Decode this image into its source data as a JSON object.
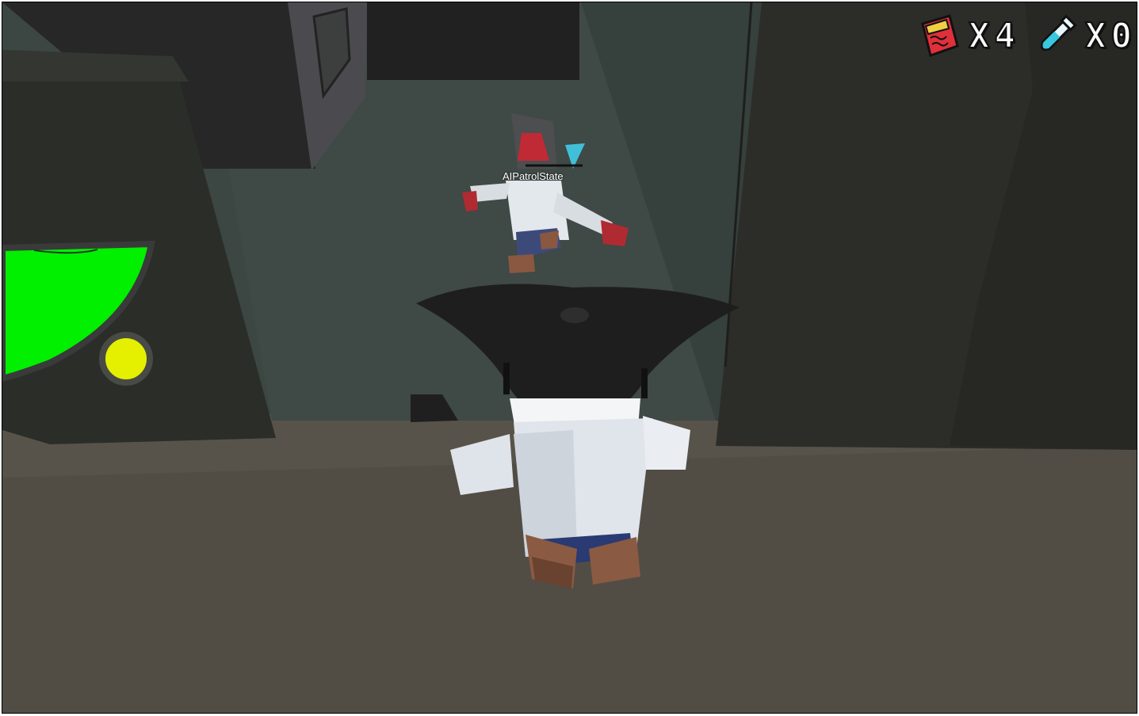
{
  "hud": {
    "cards_count": "X4",
    "vials_count": "X0",
    "cards_icon": "red-card-icon",
    "vials_icon": "test-tube-icon"
  },
  "world": {
    "enemy_state_label": "AIPatrolState"
  },
  "colors": {
    "wall_back": "#3f4a46",
    "floor": "#5a554c",
    "machine": "#2a2d29",
    "screen_green": "#00f000",
    "indicator_yellow": "#e6f000",
    "lab_coat": "#e8eef2",
    "hat": "#1e1e1e",
    "accent_red": "#d4243a",
    "accent_cyan": "#38c8e0"
  }
}
